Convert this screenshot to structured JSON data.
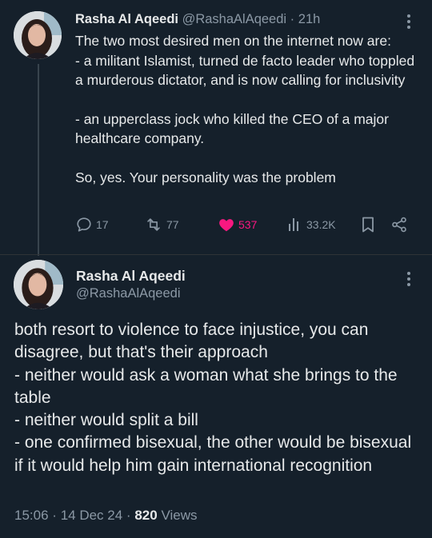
{
  "tweet1": {
    "author_name": "Rasha Al Aqeedi",
    "author_handle": "@RashaAlAqeedi",
    "separator": "·",
    "time": "21h",
    "lines": [
      "The two most desired men on the internet now are:",
      "- a militant Islamist, turned de facto leader who toppled a murderous dictator, and is now calling for inclusivity",
      "",
      "- an upperclass jock who killed the CEO of a major healthcare company.",
      "",
      "So, yes. Your personality was the problem"
    ],
    "replies": "17",
    "reposts": "77",
    "likes": "537",
    "views": "33.2K",
    "icons": {
      "reply": "reply-icon",
      "repost": "repost-icon",
      "like": "heart-icon",
      "views": "views-icon",
      "bookmark": "bookmark-icon",
      "share": "share-icon"
    },
    "like_color": "#f91880"
  },
  "tweet2": {
    "author_name": "Rasha Al Aqeedi",
    "author_handle": "@RashaAlAqeedi",
    "lines": [
      "both resort to violence to face injustice, you can disagree, but that's their approach",
      "- neither would ask a woman what she brings to the table",
      "- neither would split a bill",
      "- one confirmed bisexual, the other would be bisexual if it would help him gain international recognition"
    ],
    "time": "15:06",
    "date": "14 Dec 24",
    "views_count": "820",
    "views_label": "Views",
    "separator": "·"
  },
  "colors": {
    "background": "#15202b",
    "text": "#e7e9ea",
    "muted": "#8b98a5"
  }
}
